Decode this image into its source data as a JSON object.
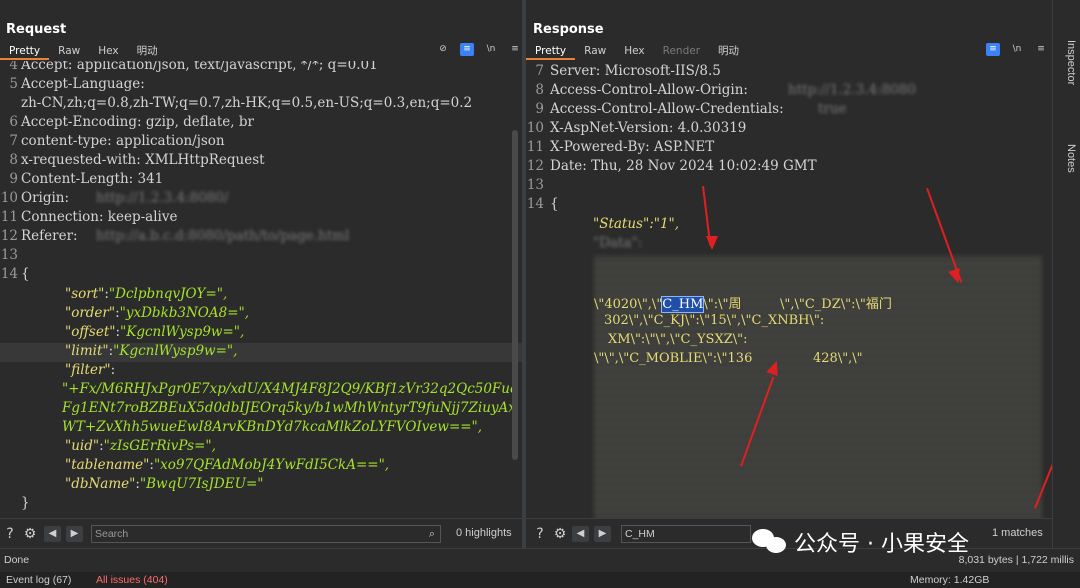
{
  "request": {
    "title": "Request",
    "tabs": [
      "Pretty",
      "Raw",
      "Hex",
      "明动"
    ],
    "tool_wrap": "\\n",
    "lines": [
      {
        "n": "4",
        "t": "Accept: application/json, text/javascript, */*; q=0.01"
      },
      {
        "n": "5",
        "t": "Accept-Language:"
      },
      {
        "n": "",
        "t": "zh-CN,zh;q=0.8,zh-TW;q=0.7,zh-HK;q=0.5,en-US;q=0.3,en;q=0.2"
      },
      {
        "n": "6",
        "t": "Accept-Encoding: gzip, deflate, br"
      },
      {
        "n": "7",
        "t": "content-type: application/json"
      },
      {
        "n": "8",
        "t": "x-requested-with: XMLHttpRequest"
      },
      {
        "n": "9",
        "t": "Content-Length: 341"
      },
      {
        "n": "10",
        "t": "Origin:"
      },
      {
        "n": "11",
        "t": "Connection: keep-alive"
      },
      {
        "n": "12",
        "t": "Referer:"
      },
      {
        "n": "13",
        "t": ""
      },
      {
        "n": "14",
        "t": "{"
      }
    ],
    "json_body": [
      {
        "k": "\"sort\"",
        "v": "\"DclpbnqvJOY=\","
      },
      {
        "k": "\"order\"",
        "v": "\"yxDbkb3NOA8=\","
      },
      {
        "k": "\"offset\"",
        "v": "\"KgcnlWysp9w=\","
      },
      {
        "k": "\"limit\"",
        "v": "\"KgcnlWysp9w=\","
      },
      {
        "k": "\"filter\"",
        "v": ""
      },
      {
        "k": "",
        "v": "\"+Fx/M6RHJxPgr0E7xp/xdU/X4MJ4F8J2Q9/KBf1zVr32q2Qc50Fuc"
      },
      {
        "k": "",
        "v": "Fg1ENt7roBZBEuX5d0dbIJEOrq5ky/b1wMhWntyrT9fuNjj7ZiuyAx"
      },
      {
        "k": "",
        "v": "WT+ZvXhh5wueEwI8ArvKBnDYd7kcaMlkZoLYFVOIvew==\","
      },
      {
        "k": "\"uid\"",
        "v": "\"zIsGErRivPs=\","
      },
      {
        "k": "\"tablename\"",
        "v": "\"xo97QFAdMobJ4YwFdI5CkA==\","
      },
      {
        "k": "\"dbName\"",
        "v": "\"BwqU7IsJDEU=\""
      }
    ],
    "closing": "}",
    "search_placeholder": "Search",
    "highlights": "0 highlights"
  },
  "response": {
    "title": "Response",
    "tabs": [
      "Pretty",
      "Raw",
      "Hex",
      "Render",
      "明动"
    ],
    "tool_wrap": "\\n",
    "lines": [
      {
        "n": "7",
        "t": "Server: Microsoft-IIS/8.5"
      },
      {
        "n": "8",
        "t": "Access-Control-Allow-Origin:"
      },
      {
        "n": "9",
        "t": "Access-Control-Allow-Credentials:"
      },
      {
        "n": "10",
        "t": "X-AspNet-Version: 4.0.30319"
      },
      {
        "n": "11",
        "t": "X-Powered-By: ASP.NET"
      },
      {
        "n": "12",
        "t": "Date: Thu, 28 Nov 2024 10:02:49 GMT"
      },
      {
        "n": "13",
        "t": ""
      },
      {
        "n": "14",
        "t": "{"
      }
    ],
    "status_line": "\"Status\":\"1\",",
    "fragments": {
      "f1": "\\\"4020\\\",\\\"",
      "f1_hl": "C_HM",
      "f1_rest": "\\\":\\\"周",
      "f1b": "\\\",\\\"C_DZ\\\":\\\"福门",
      "f2": "302\\\",\\\"C_KJ\\\":\\\"15\\\",\\\"C_XNBH\\\":",
      "f3": "XM\\\":\\\"\\\",\\\"C_YSXZ\\\":",
      "f4": "\\\"\\\",\\\"C_MOBLIE\\\":\\\"136",
      "f4b": "428\\\",\\\""
    },
    "search_value": "C_HM",
    "matches": "1 matches",
    "size": "8,031 bytes | 1,722 millis"
  },
  "side_tabs": [
    "Inspector",
    "Notes"
  ],
  "status": "Done",
  "bottom": {
    "event_log": "Event log (67)",
    "all_issues": "All issues (404)",
    "memory": "Memory: 1.42GB"
  },
  "watermark": "公众号 · 小果安全",
  "colors": {
    "accent": "#3b82f6",
    "arrow": "#e02020",
    "key": "#e6db74",
    "value": "#a6e22e"
  }
}
